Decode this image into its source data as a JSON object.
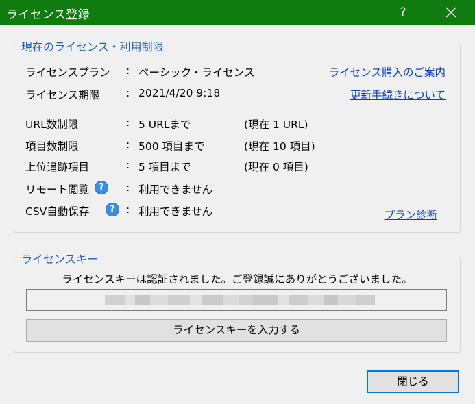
{
  "window": {
    "title": "ライセンス登録",
    "help_label": "?"
  },
  "license_group": {
    "title": "現在のライセンス・利用制限",
    "colon": ":",
    "rows": [
      {
        "label": "ライセンスプラン",
        "value": "ベーシック・ライセンス",
        "current": ""
      },
      {
        "label": "ライセンス期限",
        "value": "2021/4/20 9:18",
        "current": ""
      },
      {
        "label": "URL数制限",
        "value": "5 URLまで",
        "current": "(現在 1 URL)"
      },
      {
        "label": "項目数制限",
        "value": "500 項目まで",
        "current": "(現在 10 項目)"
      },
      {
        "label": "上位追跡項目",
        "value": "5 項目まで",
        "current": "(現在 0 項目)"
      },
      {
        "label": "リモート閲覧",
        "value": "利用できません",
        "current": "",
        "help_icon": "?"
      },
      {
        "label": "CSV自動保存",
        "value": "利用できません",
        "current": "",
        "help_icon": "?"
      }
    ],
    "links": {
      "purchase": "ライセンス購入のご案内",
      "renewal": "更新手続きについて",
      "diagnosis": "プラン診断"
    }
  },
  "key_group": {
    "title": "ライセンスキー",
    "message": "ライセンスキーは認証されました。ご登録誠にありがとうございました。",
    "enter_button": "ライセンスキーを入力する"
  },
  "footer": {
    "close_button": "閉じる"
  },
  "colors": {
    "titlebar": "#107c10",
    "group_title": "#1a5fb4",
    "link": "#0a3fb8",
    "help_icon": "#3b8ee0",
    "focus_border": "#0078d7"
  }
}
